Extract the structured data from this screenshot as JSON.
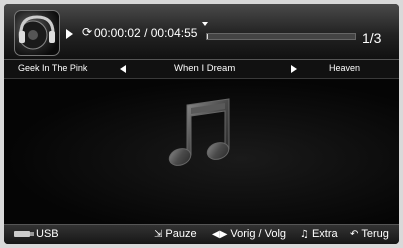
{
  "player": {
    "elapsed": "00:00:02",
    "separator": "/",
    "duration": "00:04:55",
    "progress_fraction": 0.01,
    "page_count": "1/3"
  },
  "tracks": {
    "previous": "Geek In The Pink",
    "current": "When I Dream",
    "next": "Heaven"
  },
  "footer": {
    "source": "USB",
    "pause_label": "Pauze",
    "prev_next_label": "Vorig / Volg",
    "extra_label": "Extra",
    "back_label": "Terug"
  },
  "icons": {
    "thumbnail": "album-art-icon",
    "play": "play-icon",
    "repeat": "repeat-icon",
    "music": "music-note-icon",
    "usb": "usb-icon"
  },
  "colors": {
    "background": "#000000",
    "text": "#ffffff",
    "progress_track": "#444444"
  }
}
